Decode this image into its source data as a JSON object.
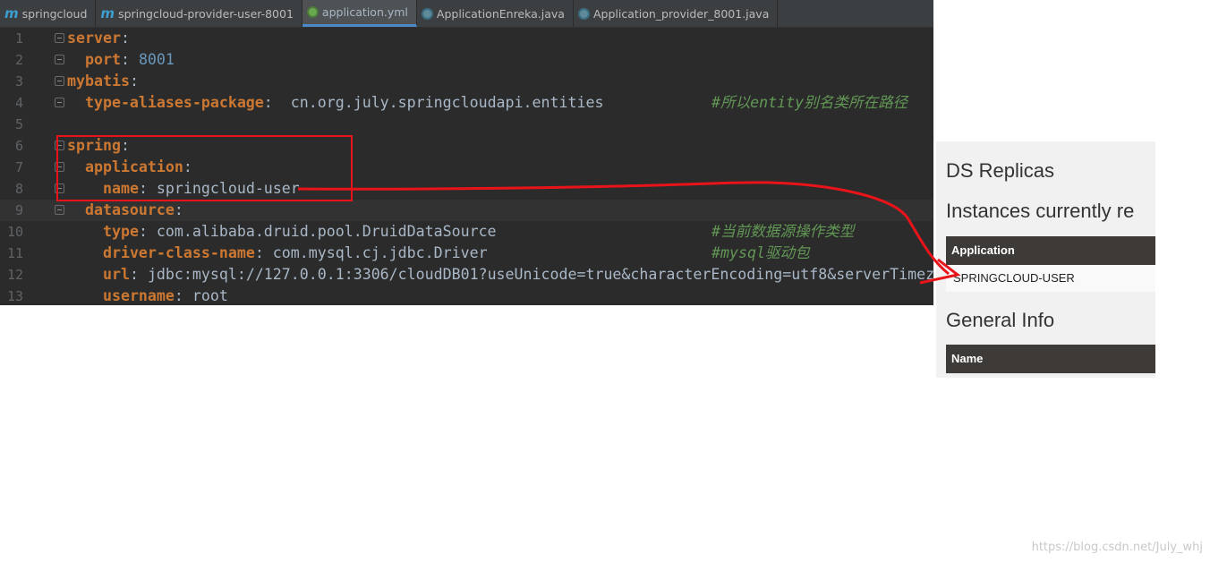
{
  "tabs": [
    {
      "label": "springcloud",
      "icon": "maven-module-icon",
      "active": false
    },
    {
      "label": "springcloud-provider-user-8001",
      "icon": "maven-module-icon",
      "active": false
    },
    {
      "label": "application.yml",
      "icon": "spring-yaml-icon",
      "active": true
    },
    {
      "label": "ApplicationEnreka.java",
      "icon": "spring-boot-class-icon",
      "active": false
    },
    {
      "label": "Application_provider_8001.java",
      "icon": "spring-boot-class-icon",
      "active": false
    }
  ],
  "code": [
    {
      "n": "1",
      "indent": "",
      "key": "server",
      "sep": ":",
      "val": "",
      "valType": "",
      "comment": "",
      "fold": true
    },
    {
      "n": "2",
      "indent": "  ",
      "key": "port",
      "sep": ": ",
      "val": "8001",
      "valType": "n",
      "comment": "",
      "fold": true
    },
    {
      "n": "3",
      "indent": "",
      "key": "mybatis",
      "sep": ":",
      "val": "",
      "valType": "",
      "comment": "",
      "fold": true
    },
    {
      "n": "4",
      "indent": "  ",
      "key": "type-aliases-package",
      "sep": ":  ",
      "val": "cn.org.july.springcloudapi.entities",
      "valType": "",
      "comment": "#所以entity别名类所在路径",
      "fold": true
    },
    {
      "n": "5",
      "indent": "",
      "key": "",
      "sep": "",
      "val": "",
      "valType": "",
      "comment": "",
      "fold": false
    },
    {
      "n": "6",
      "indent": "",
      "key": "spring",
      "sep": ":",
      "val": "",
      "valType": "",
      "comment": "",
      "fold": true
    },
    {
      "n": "7",
      "indent": "  ",
      "key": "application",
      "sep": ":",
      "val": "",
      "valType": "",
      "comment": "",
      "fold": true
    },
    {
      "n": "8",
      "indent": "    ",
      "key": "name",
      "sep": ": ",
      "val": "springcloud-user",
      "valType": "",
      "comment": "",
      "fold": true
    },
    {
      "n": "9",
      "indent": "  ",
      "key": "datasource",
      "sep": ":",
      "val": "",
      "valType": "",
      "comment": "",
      "fold": true,
      "current": true
    },
    {
      "n": "10",
      "indent": "    ",
      "key": "type",
      "sep": ": ",
      "val": "com.alibaba.druid.pool.DruidDataSource",
      "valType": "",
      "comment": "#当前数据源操作类型",
      "fold": false
    },
    {
      "n": "11",
      "indent": "    ",
      "key": "driver-class-name",
      "sep": ": ",
      "val": "com.mysql.cj.jdbc.Driver",
      "valType": "",
      "comment": "#mysql驱动包",
      "fold": false
    },
    {
      "n": "12",
      "indent": "    ",
      "key": "url",
      "sep": ": ",
      "val": "jdbc:mysql://127.0.0.1:3306/cloudDB01?useUnicode=true&characterEncoding=utf8&serverTimez",
      "valType": "",
      "comment": "",
      "fold": false
    },
    {
      "n": "13",
      "indent": "    ",
      "key": "username",
      "sep": ": ",
      "val": "root",
      "valType": "",
      "comment": "",
      "fold": false
    }
  ],
  "eureka": {
    "ds_replicas": "DS Replicas",
    "instances_title": "Instances currently re",
    "app_header": "Application",
    "app_row": "SPRINGCLOUD-USER",
    "general_info": "General Info",
    "name_header": "Name"
  },
  "annotation_color": "#e8141a",
  "watermark": "https://blog.csdn.net/July_whj"
}
